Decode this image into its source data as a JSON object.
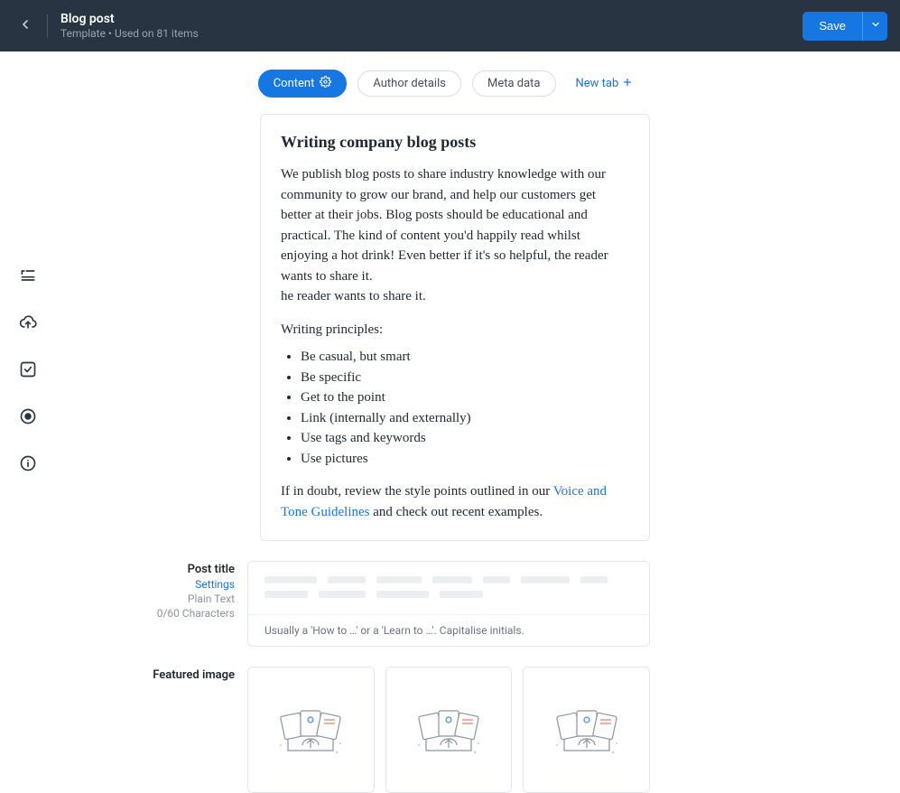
{
  "header": {
    "title": "Blog post",
    "subtitle": "Template • Used on 81 items",
    "save_label": "Save"
  },
  "tabs": {
    "items": [
      {
        "label": "Content",
        "active": true,
        "has_gear": true
      },
      {
        "label": "Author details",
        "active": false,
        "has_gear": false
      },
      {
        "label": "Meta data",
        "active": false,
        "has_gear": false
      }
    ],
    "new_tab_label": "New tab"
  },
  "guidelines": {
    "heading": "Writing company blog posts",
    "body_line1": "We publish blog posts to share industry knowledge with our community to grow our brand, and help our customers get better at their jobs. Blog posts should be educational and practical. The kind of content you'd happily read whilst enjoying a hot drink! Even better if it's so helpful, the reader wants to share it.",
    "body_line2": "he reader wants to share it.",
    "principles_heading": "Writing principles:",
    "principles": [
      "Be casual, but smart",
      "Be specific",
      "Get to the point",
      "Link (internally and externally)",
      "Use tags and keywords",
      "Use pictures"
    ],
    "footer_prefix": "If in doubt, review the style points outlined in our ",
    "footer_link": "Voice and Tone Guidelines",
    "footer_suffix": " and check out recent examples."
  },
  "post_title_field": {
    "name": "Post title",
    "settings_label": "Settings",
    "type_label": "Plain Text",
    "count_label": "0/60 Characters",
    "help_text": "Usually a 'How to …' or a 'Learn to …'. Capitalise initials."
  },
  "featured_image_field": {
    "name": "Featured image",
    "slot_count": 3
  },
  "icons": {
    "back": "chevron-left",
    "save_caret": "chevron-down",
    "gear": "gear",
    "plus": "plus",
    "rail": [
      "text-lines",
      "cloud-upload",
      "checkbox",
      "radio",
      "info"
    ]
  },
  "colors": {
    "accent": "#1676e2",
    "header_bg": "#293442",
    "border": "#e3e7eb",
    "text": "#1f2933",
    "muted": "#8a94a0"
  }
}
